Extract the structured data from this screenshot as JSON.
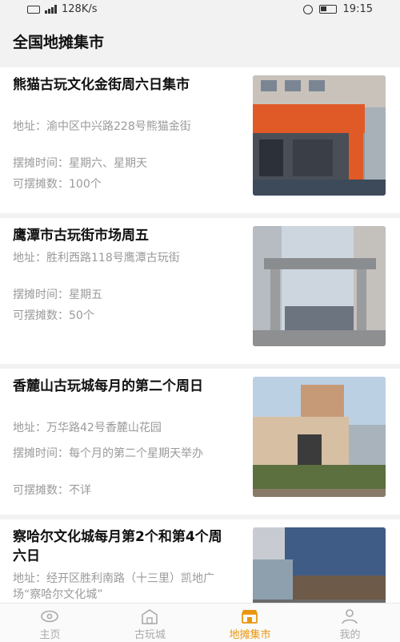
{
  "status_bar": {
    "speed": "128K/s",
    "time": "19:15"
  },
  "header": {
    "title": "全国地摊集市"
  },
  "markets": [
    {
      "title": "熊猫古玩文化金街周六日集市",
      "address": "地址：渝中区中兴路228号熊猫金街",
      "time": "摆摊时间：星期六、星期天",
      "count": "可摆摊数：100个"
    },
    {
      "title": "鹰潭市古玩街市场周五",
      "address": "地址：胜利西路118号鹰潭古玩街",
      "time": "摆摊时间：星期五",
      "count": "可摆摊数：50个"
    },
    {
      "title": "香麓山古玩城每月的第二个周日",
      "address": "地址：万华路42号香麓山花园",
      "time": "摆摊时间：每个月的第二个星期天举办",
      "count": "可摆摊数：不详"
    },
    {
      "title": "察哈尔文化城每月第2个和第4个周六日",
      "address": "地址：经开区胜利南路（十三里）凯地广场“察哈尔文化城”",
      "time": "",
      "count": ""
    }
  ],
  "tabs": [
    {
      "label": "主页",
      "icon": "eye-icon"
    },
    {
      "label": "古玩城",
      "icon": "building-icon"
    },
    {
      "label": "地摊集市",
      "icon": "stall-icon"
    },
    {
      "label": "我的",
      "icon": "person-icon"
    }
  ],
  "active_tab": "地摊集市",
  "colors": {
    "accent": "#e9960f",
    "background": "#f2f2f2",
    "muted_text": "#9a9a9a"
  }
}
